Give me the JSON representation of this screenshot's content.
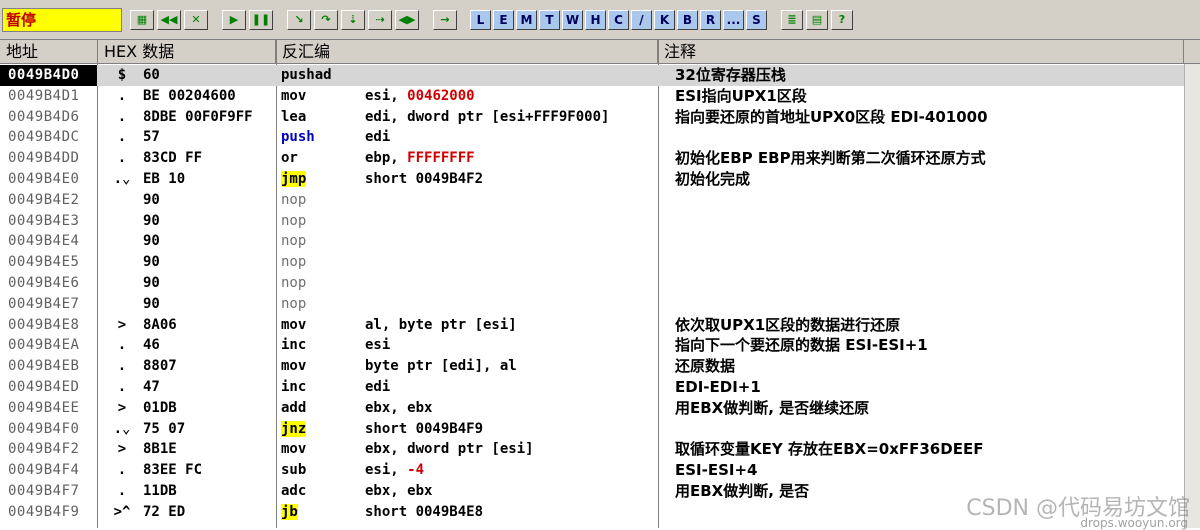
{
  "window": {
    "status": "暂停"
  },
  "toolbar": {
    "buttons": [
      {
        "icon": "open-icon",
        "label": "▦"
      },
      {
        "icon": "rewind-icon",
        "label": "◀◀"
      },
      {
        "icon": "close-program-icon",
        "label": "✕"
      },
      {
        "icon": "run-icon",
        "label": "▶"
      },
      {
        "icon": "pause-icon",
        "label": "❚❚"
      },
      {
        "icon": "step-into-icon",
        "label": "↘"
      },
      {
        "icon": "step-over-icon",
        "label": "↷"
      },
      {
        "icon": "trace-into-icon",
        "label": "⇣"
      },
      {
        "icon": "trace-over-icon",
        "label": "⇢"
      },
      {
        "icon": "execute-till-return-icon",
        "label": "◀▶"
      },
      {
        "icon": "goto-icon",
        "label": "→"
      }
    ],
    "letters": [
      "L",
      "E",
      "M",
      "T",
      "W",
      "H",
      "C",
      "/",
      "K",
      "B",
      "R",
      "...",
      "S"
    ],
    "extra": [
      {
        "icon": "list-icon",
        "label": "≣"
      },
      {
        "icon": "options-icon",
        "label": "▤"
      },
      {
        "icon": "help-icon",
        "label": "?"
      }
    ]
  },
  "columns": {
    "address": "地址",
    "hex": "HEX 数据",
    "disasm": "反汇编",
    "comment": "注释"
  },
  "rows": [
    {
      "addr": "0049B4D0",
      "mark": "$",
      "hex": "60",
      "mn": "pushad",
      "op": "",
      "cm": "32位寄存器压栈",
      "selected": true
    },
    {
      "addr": "0049B4D1",
      "mark": ".",
      "hex": "BE 00204600",
      "mn": "mov",
      "op": "esi, ",
      "opred": "00462000",
      "cm": "ESI指向UPX1区段"
    },
    {
      "addr": "0049B4D6",
      "mark": ".",
      "hex": "8DBE 00F0F9FF",
      "mn": "lea",
      "op": "edi, dword ptr [esi+FFF9F000]",
      "cm": "指向要还原的首地址UPX0区段 EDI-401000"
    },
    {
      "addr": "0049B4DC",
      "mark": ".",
      "hex": "57",
      "mn": "push",
      "mnstyle": "blue",
      "op": "edi",
      "cm": ""
    },
    {
      "addr": "0049B4DD",
      "mark": ".",
      "hex": "83CD FF",
      "mn": "or",
      "op": "ebp, ",
      "opred": "FFFFFFFF",
      "cm": "初始化EBP EBP用来判断第二次循环还原方式"
    },
    {
      "addr": "0049B4E0",
      "mark": ".⌄",
      "hex": "EB 10",
      "mn": "jmp",
      "mnstyle": "hl",
      "op": "short 0049B4F2",
      "cm": "初始化完成"
    },
    {
      "addr": "0049B4E2",
      "mark": "",
      "hex": "90",
      "mn": "nop",
      "mnstyle": "gray",
      "op": "",
      "cm": ""
    },
    {
      "addr": "0049B4E3",
      "mark": "",
      "hex": "90",
      "mn": "nop",
      "mnstyle": "gray",
      "op": "",
      "cm": ""
    },
    {
      "addr": "0049B4E4",
      "mark": "",
      "hex": "90",
      "mn": "nop",
      "mnstyle": "gray",
      "op": "",
      "cm": ""
    },
    {
      "addr": "0049B4E5",
      "mark": "",
      "hex": "90",
      "mn": "nop",
      "mnstyle": "gray",
      "op": "",
      "cm": ""
    },
    {
      "addr": "0049B4E6",
      "mark": "",
      "hex": "90",
      "mn": "nop",
      "mnstyle": "gray",
      "op": "",
      "cm": ""
    },
    {
      "addr": "0049B4E7",
      "mark": "",
      "hex": "90",
      "mn": "nop",
      "mnstyle": "gray",
      "op": "",
      "cm": ""
    },
    {
      "addr": "0049B4E8",
      "mark": ">",
      "hex": "8A06",
      "mn": "mov",
      "op": "al, byte ptr [esi]",
      "cm": "依次取UPX1区段的数据进行还原"
    },
    {
      "addr": "0049B4EA",
      "mark": ".",
      "hex": "46",
      "mn": "inc",
      "op": "esi",
      "cm": "指向下一个要还原的数据 ESI-ESI+1"
    },
    {
      "addr": "0049B4EB",
      "mark": ".",
      "hex": "8807",
      "mn": "mov",
      "op": "byte ptr [edi], al",
      "cm": "还原数据"
    },
    {
      "addr": "0049B4ED",
      "mark": ".",
      "hex": "47",
      "mn": "inc",
      "op": "edi",
      "cm": "EDI-EDI+1"
    },
    {
      "addr": "0049B4EE",
      "mark": ">",
      "hex": "01DB",
      "mn": "add",
      "op": "ebx, ebx",
      "cm": "用EBX做判断, 是否继续还原"
    },
    {
      "addr": "0049B4F0",
      "mark": ".⌄",
      "hex": "75 07",
      "mn": "jnz",
      "mnstyle": "hl",
      "op": "short 0049B4F9",
      "cm": ""
    },
    {
      "addr": "0049B4F2",
      "mark": ">",
      "hex": "8B1E",
      "mn": "mov",
      "op": "ebx, dword ptr [esi]",
      "cm": "取循环变量KEY 存放在EBX=0xFF36DEEF"
    },
    {
      "addr": "0049B4F4",
      "mark": ".",
      "hex": "83EE FC",
      "mn": "sub",
      "op": "esi, ",
      "opred": "-4",
      "cm": "ESI-ESI+4"
    },
    {
      "addr": "0049B4F7",
      "mark": ".",
      "hex": "11DB",
      "mn": "adc",
      "op": "ebx, ebx",
      "cm": "用EBX做判断, 是否"
    },
    {
      "addr": "0049B4F9",
      "mark": ">^",
      "hex": "72 ED",
      "mn": "jb",
      "mnstyle": "hl",
      "op": "short 0049B4E8",
      "cm": ""
    }
  ],
  "watermark": {
    "text": "CSDN @代码易坊文馆",
    "sub": "drops.wooyun.org"
  }
}
